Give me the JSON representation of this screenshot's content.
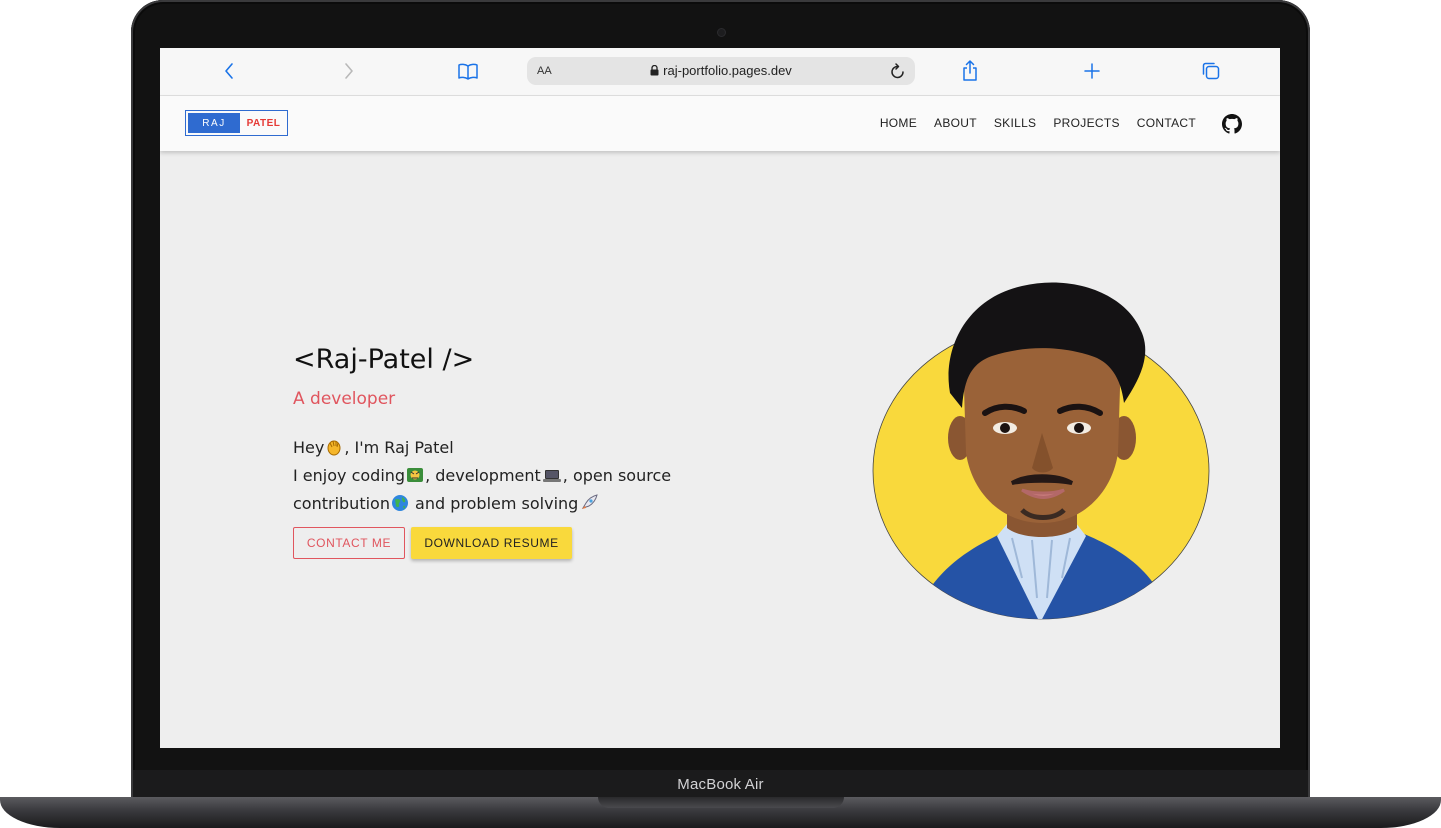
{
  "browser": {
    "text_size_label": "AA",
    "url": "raj-portfolio.pages.dev"
  },
  "site": {
    "logo_first": "RAJ",
    "logo_last": "PATEL",
    "nav": [
      "HOME",
      "ABOUT",
      "SKILLS",
      "PROJECTS",
      "CONTACT"
    ]
  },
  "hero": {
    "title": "<Raj-Patel />",
    "subtitle": "A developer",
    "line1_a": "Hey",
    "line1_b": ", I'm Raj Patel",
    "line2_a": "I enjoy coding",
    "line2_b": ", development",
    "line2_c": ", open source",
    "line3_a": "contribution",
    "line3_b": " and problem solving",
    "contact_button": "CONTACT ME",
    "resume_button": "DOWNLOAD RESUME"
  },
  "device": {
    "label": "MacBook Air"
  },
  "colors": {
    "accent_red": "#e0555e",
    "accent_yellow": "#f9d93c",
    "brand_blue": "#2f6bd0",
    "safari_blue": "#1a73e8"
  },
  "icons": [
    "back-icon",
    "forward-icon",
    "bookmarks-icon",
    "lock-icon",
    "reload-icon",
    "share-icon",
    "new-tab-icon",
    "tabs-icon",
    "github-icon"
  ]
}
